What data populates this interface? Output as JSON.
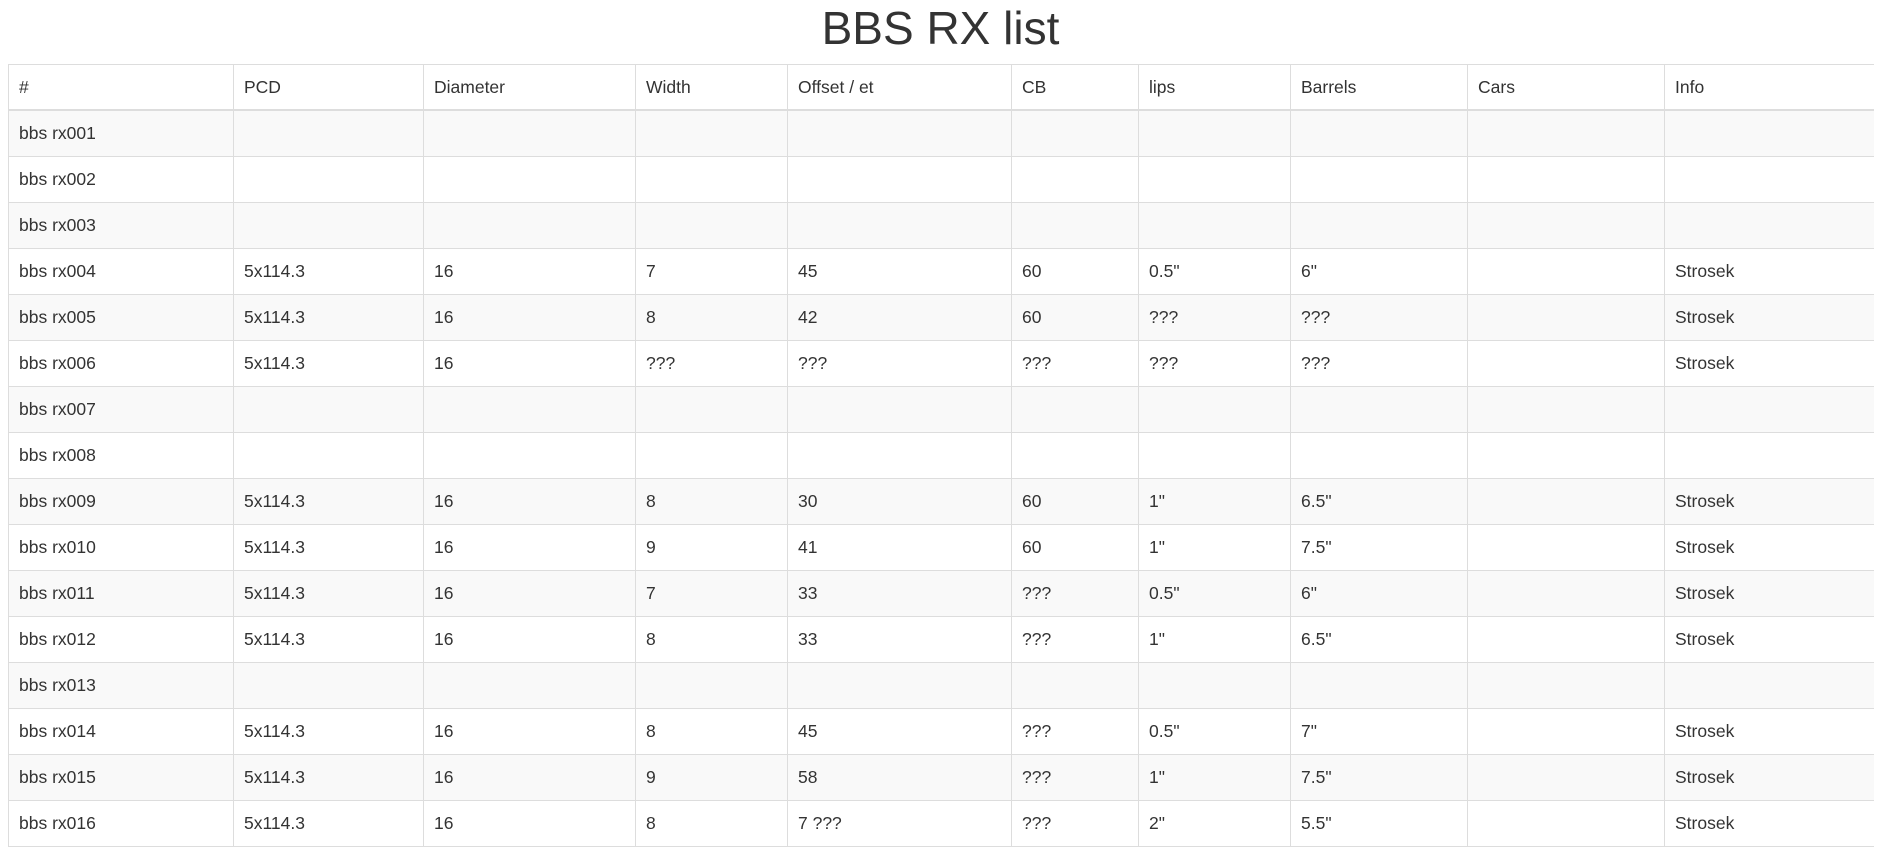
{
  "title": "BBS RX list",
  "table": {
    "columns": [
      "#",
      "PCD",
      "Diameter",
      "Width",
      "Offset / et",
      "CB",
      "lips",
      "Barrels",
      "Cars",
      "Info"
    ],
    "rows": [
      [
        "bbs rx001",
        "",
        "",
        "",
        "",
        "",
        "",
        "",
        "",
        ""
      ],
      [
        "bbs rx002",
        "",
        "",
        "",
        "",
        "",
        "",
        "",
        "",
        ""
      ],
      [
        "bbs rx003",
        "",
        "",
        "",
        "",
        "",
        "",
        "",
        "",
        ""
      ],
      [
        "bbs rx004",
        "5x114.3",
        "16",
        "7",
        "45",
        "60",
        "0.5\"",
        "6\"",
        "",
        "Strosek"
      ],
      [
        "bbs rx005",
        "5x114.3",
        "16",
        "8",
        "42",
        "60",
        "???",
        "???",
        "",
        "Strosek"
      ],
      [
        "bbs rx006",
        "5x114.3",
        "16",
        "???",
        "???",
        "???",
        "???",
        "???",
        "",
        "Strosek"
      ],
      [
        "bbs rx007",
        "",
        "",
        "",
        "",
        "",
        "",
        "",
        "",
        ""
      ],
      [
        "bbs rx008",
        "",
        "",
        "",
        "",
        "",
        "",
        "",
        "",
        ""
      ],
      [
        "bbs rx009",
        "5x114.3",
        "16",
        "8",
        "30",
        "60",
        "1\"",
        "6.5\"",
        "",
        "Strosek"
      ],
      [
        "bbs rx010",
        "5x114.3",
        "16",
        "9",
        "41",
        "60",
        "1\"",
        "7.5\"",
        "",
        "Strosek"
      ],
      [
        "bbs rx011",
        "5x114.3",
        "16",
        "7",
        "33",
        "???",
        "0.5\"",
        "6\"",
        "",
        "Strosek"
      ],
      [
        "bbs rx012",
        "5x114.3",
        "16",
        "8",
        "33",
        "???",
        "1\"",
        "6.5\"",
        "",
        "Strosek"
      ],
      [
        "bbs rx013",
        "",
        "",
        "",
        "",
        "",
        "",
        "",
        "",
        ""
      ],
      [
        "bbs rx014",
        "5x114.3",
        "16",
        "8",
        "45",
        "???",
        "0.5\"",
        "7\"",
        "",
        "Strosek"
      ],
      [
        "bbs rx015",
        "5x114.3",
        "16",
        "9",
        "58",
        "???",
        "1\"",
        "7.5\"",
        "",
        "Strosek"
      ],
      [
        "bbs rx016",
        "5x114.3",
        "16",
        "8",
        "7 ???",
        "???",
        "2\"",
        "5.5\"",
        "",
        "Strosek"
      ]
    ]
  }
}
